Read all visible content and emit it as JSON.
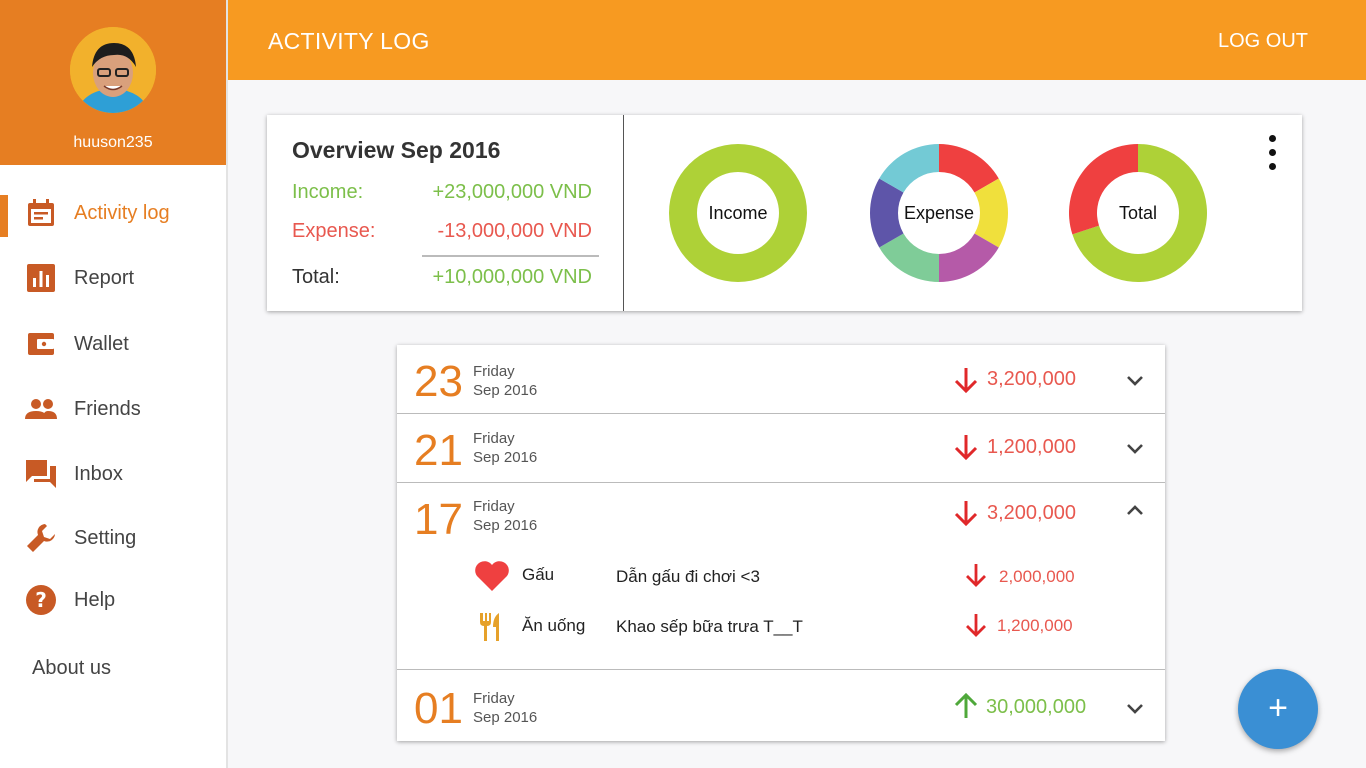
{
  "profile": {
    "username": "huuson235"
  },
  "nav": [
    {
      "label": "Activity log",
      "icon": "calendar-icon"
    },
    {
      "label": "Report",
      "icon": "bar-chart-icon"
    },
    {
      "label": "Wallet",
      "icon": "wallet-icon"
    },
    {
      "label": "Friends",
      "icon": "people-icon"
    },
    {
      "label": "Inbox",
      "icon": "chat-icon"
    },
    {
      "label": "Setting",
      "icon": "wrench-icon"
    },
    {
      "label": "Help",
      "icon": "help-icon"
    }
  ],
  "about": "About us",
  "header": {
    "title": "ACTIVITY LOG",
    "logout": "LOG OUT"
  },
  "overview": {
    "title": "Overview Sep 2016",
    "income_label": "Income:",
    "income_value": "+23,000,000 VND",
    "expense_label": "Expense:",
    "expense_value": "-13,000,000 VND",
    "total_label": "Total:",
    "total_value": "+10,000,000 VND",
    "donuts": [
      {
        "label": "Income",
        "segments": [
          {
            "color": "#aed137",
            "value": 1
          }
        ]
      },
      {
        "label": "Expense",
        "segments": [
          {
            "color": "#ef4040",
            "value": 1
          },
          {
            "color": "#f0e03c",
            "value": 1
          },
          {
            "color": "#b55aa8",
            "value": 1
          },
          {
            "color": "#7fcc98",
            "value": 1
          },
          {
            "color": "#5e55a9",
            "value": 1
          },
          {
            "color": "#73cad5",
            "value": 1
          }
        ]
      },
      {
        "label": "Total",
        "segments": [
          {
            "color": "#aed137",
            "value": 70
          },
          {
            "color": "#ef4040",
            "value": 30
          }
        ]
      }
    ]
  },
  "log": [
    {
      "day": "23",
      "weekday": "Friday",
      "month": "Sep 2016",
      "direction": "down",
      "amount": "3,200,000",
      "expanded": false
    },
    {
      "day": "21",
      "weekday": "Friday",
      "month": "Sep 2016",
      "direction": "down",
      "amount": "1,200,000",
      "expanded": false
    },
    {
      "day": "17",
      "weekday": "Friday",
      "month": "Sep 2016",
      "direction": "down",
      "amount": "3,200,000",
      "expanded": true,
      "items": [
        {
          "icon": "heart-icon",
          "category": "Gấu",
          "note": "Dẫn gấu đi chơi <3",
          "amount": "2,000,000"
        },
        {
          "icon": "fork-knife-icon",
          "category": "Ăn uống",
          "note": "Khao sếp bữa trưa T__T",
          "amount": "1,200,000"
        }
      ]
    },
    {
      "day": "01",
      "weekday": "Friday",
      "month": "Sep 2016",
      "direction": "up",
      "amount": "30,000,000",
      "expanded": false
    }
  ],
  "fab": {
    "label": "+"
  },
  "colors": {
    "accent": "#e67e22",
    "header": "#f79a21",
    "income": "#7cbf4a",
    "expense": "#e8584f",
    "fab": "#3a8fd4"
  }
}
